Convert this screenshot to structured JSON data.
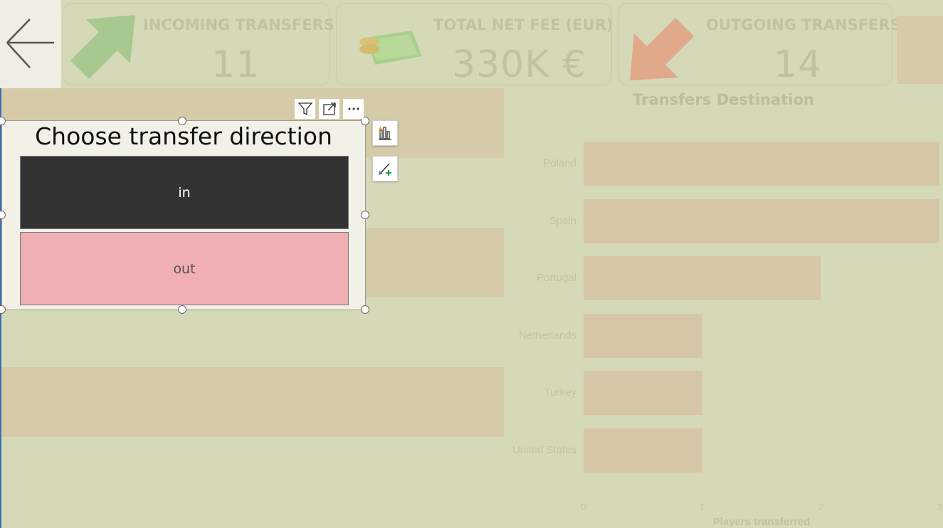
{
  "kpis": [
    {
      "title": "INCOMING TRANSFERS",
      "value": "11",
      "icon": "up-right-arrow-icon"
    },
    {
      "title": "TOTAL NET FEE (EUR)",
      "value": "330K €",
      "icon": "money-icon"
    },
    {
      "title": "OUTGOING TRANSFERS",
      "value": "14",
      "icon": "down-left-arrow-icon"
    }
  ],
  "slicer": {
    "title": "Choose transfer direction",
    "options": [
      {
        "label": "in",
        "selected": true
      },
      {
        "label": "out",
        "selected": false
      }
    ]
  },
  "toolbar": {
    "filter_icon": "filter-icon",
    "focus_icon": "focus-mode-icon",
    "more_icon": "more-options-icon",
    "build_visual_icon": "build-visual-icon",
    "format_visual_icon": "format-visual-icon"
  },
  "colors": {
    "background": "#d6d9b8",
    "bar": "#d5c6a6",
    "slicer_selected": "#333333",
    "slicer_unselected": "#f0afb3",
    "incoming_arrow": "#a7c98f",
    "outgoing_arrow": "#e0a98a"
  },
  "chart_data": {
    "type": "bar",
    "orientation": "horizontal",
    "title": "Transfers Destination",
    "categories": [
      "Poland",
      "Spain",
      "Portugal",
      "Netherlands",
      "Turkey",
      "United States"
    ],
    "values": [
      3,
      3,
      2,
      1,
      1,
      1
    ],
    "xlabel": "Players transferred",
    "ylabel": "",
    "xlim": [
      0,
      3
    ],
    "xticks": [
      "0",
      "1",
      "2",
      "3"
    ],
    "grid": false
  }
}
